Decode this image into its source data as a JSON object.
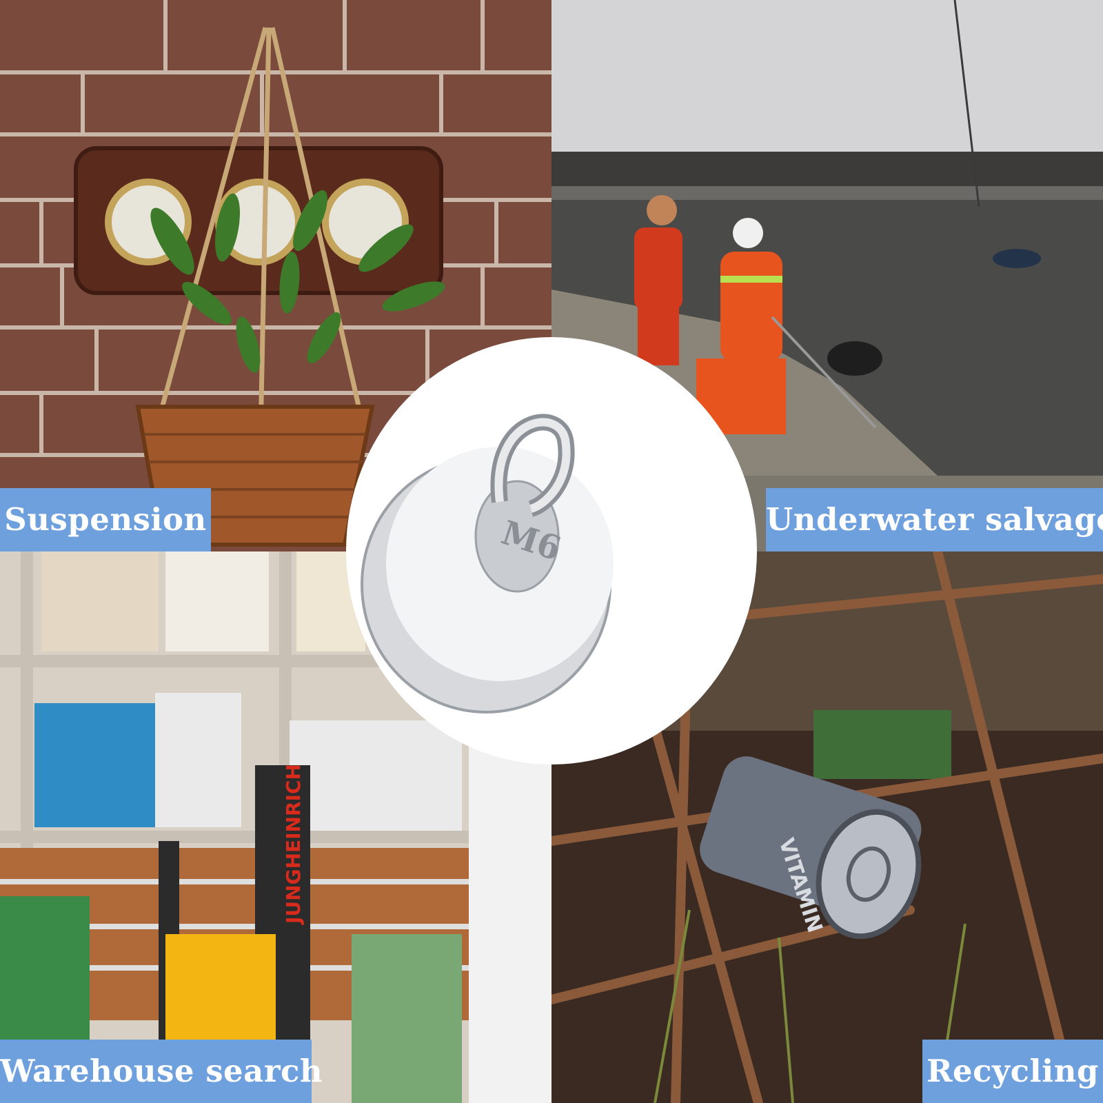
{
  "collage": {
    "panels": [
      {
        "id": "suspension",
        "label": "Suspension"
      },
      {
        "id": "underwater",
        "label": "Underwater salvage"
      },
      {
        "id": "warehouse",
        "label": "Warehouse search"
      },
      {
        "id": "recycling",
        "label": "Recycling"
      }
    ],
    "product": {
      "thread_marking": "M6",
      "forklift_brand": "JUNGHEINRICH",
      "can_text": "VITAMIN"
    },
    "colors": {
      "label_bg": "#6fa0de",
      "label_text": "#ffffff",
      "center_bg": "#ffffff"
    }
  }
}
